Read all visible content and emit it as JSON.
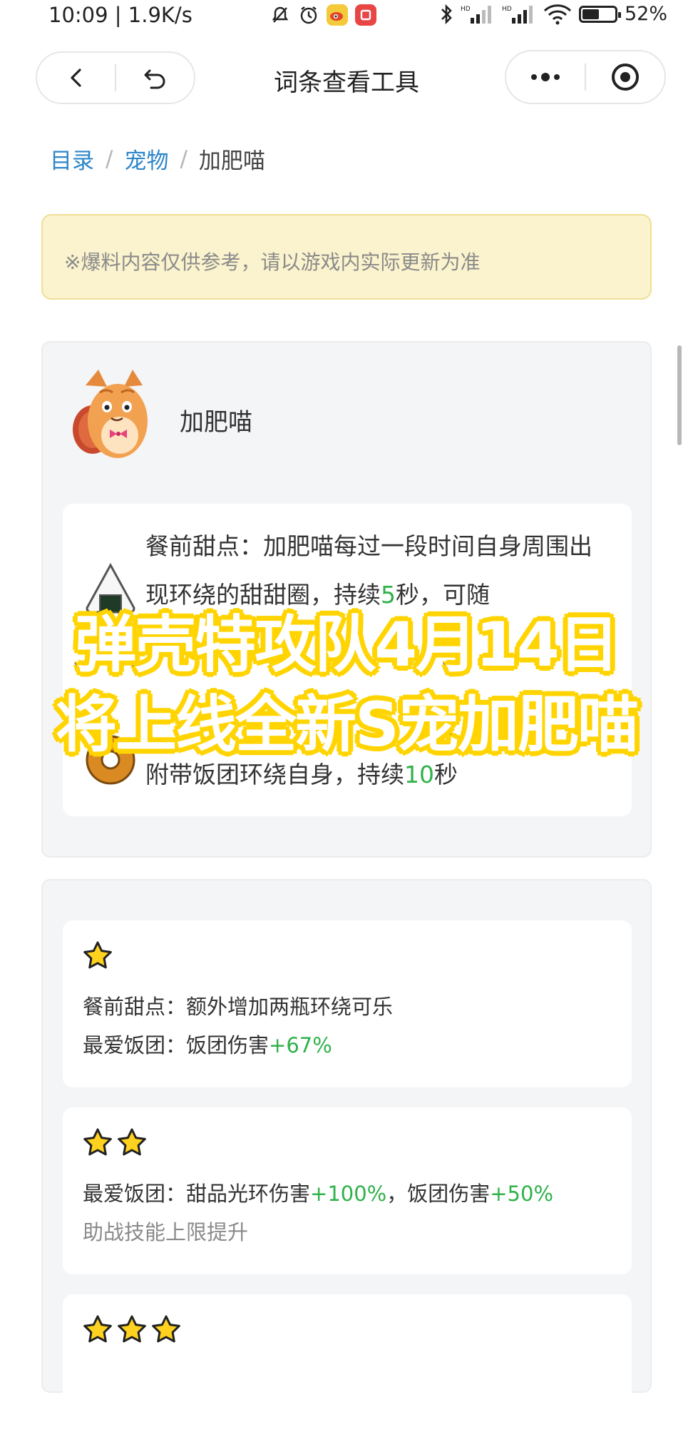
{
  "status_bar": {
    "time_speed": "10:09 | 1.9K/s",
    "battery_text": "52%",
    "battery_level": 0.52
  },
  "nav": {
    "title": "词条查看工具"
  },
  "breadcrumb": {
    "items": [
      "目录",
      "宠物",
      "加肥喵"
    ],
    "separator": "/"
  },
  "notice": {
    "text": "※爆料内容仅供参考，请以游戏内实际更新为准"
  },
  "pet": {
    "name": "加肥喵",
    "skills": [
      {
        "icon": "rice-ball-icon",
        "segments": [
          {
            "text": "餐前甜点：加肥喵每过一段时间自身周围出现环绕的甜甜圈，持续",
            "hl": false
          },
          {
            "text": "5",
            "hl": true
          },
          {
            "text": "秒，可随",
            "hl": false
          }
        ]
      },
      {
        "icon": "donut-icon",
        "segments": [
          {
            "text": "附带饭团环绕自身，持续",
            "hl": false
          },
          {
            "text": "10",
            "hl": true
          },
          {
            "text": "秒",
            "hl": false
          }
        ]
      }
    ]
  },
  "star_upgrades": [
    {
      "stars": 1,
      "lines": [
        {
          "parts": [
            {
              "text": "餐前甜点：额外增加两瓶环绕可乐",
              "hl": false
            }
          ]
        },
        {
          "parts": [
            {
              "text": "最爱饭团：饭团伤害",
              "hl": false
            },
            {
              "text": "+67%",
              "hl": true
            }
          ]
        }
      ]
    },
    {
      "stars": 2,
      "lines": [
        {
          "parts": [
            {
              "text": "最爱饭团：甜品光环伤害",
              "hl": false
            },
            {
              "text": "+100%",
              "hl": true
            },
            {
              "text": "，饭团伤害",
              "hl": false
            },
            {
              "text": "+50%",
              "hl": true
            }
          ]
        },
        {
          "grey": true,
          "parts": [
            {
              "text": "助战技能上限提升",
              "hl": false
            }
          ]
        }
      ]
    },
    {
      "stars": 3,
      "lines": []
    }
  ],
  "overlay_caption": {
    "line1": "弹壳特攻队4月14日",
    "line2": "将上线全新S宠加肥喵"
  },
  "colors": {
    "link": "#2d86c9",
    "highlight": "#2fb24a",
    "notice_bg": "#fbf3cd",
    "star": "#ffd21f",
    "caption_outline": "#ffd400"
  }
}
